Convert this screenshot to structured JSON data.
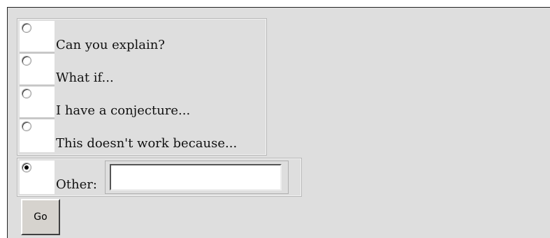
{
  "form": {
    "options": [
      {
        "label": "Can you explain?",
        "checked": false
      },
      {
        "label": "What if...",
        "checked": false
      },
      {
        "label": "I have a conjecture...",
        "checked": false
      },
      {
        "label": "This doesn't work because...",
        "checked": false
      }
    ],
    "other": {
      "label": "Other:",
      "checked": true,
      "value": "",
      "placeholder": ""
    },
    "submit_label": "Go"
  },
  "colors": {
    "panel_background": "#dedede",
    "cell_background": "#ffffff",
    "button_face": "#d6d3ce"
  }
}
